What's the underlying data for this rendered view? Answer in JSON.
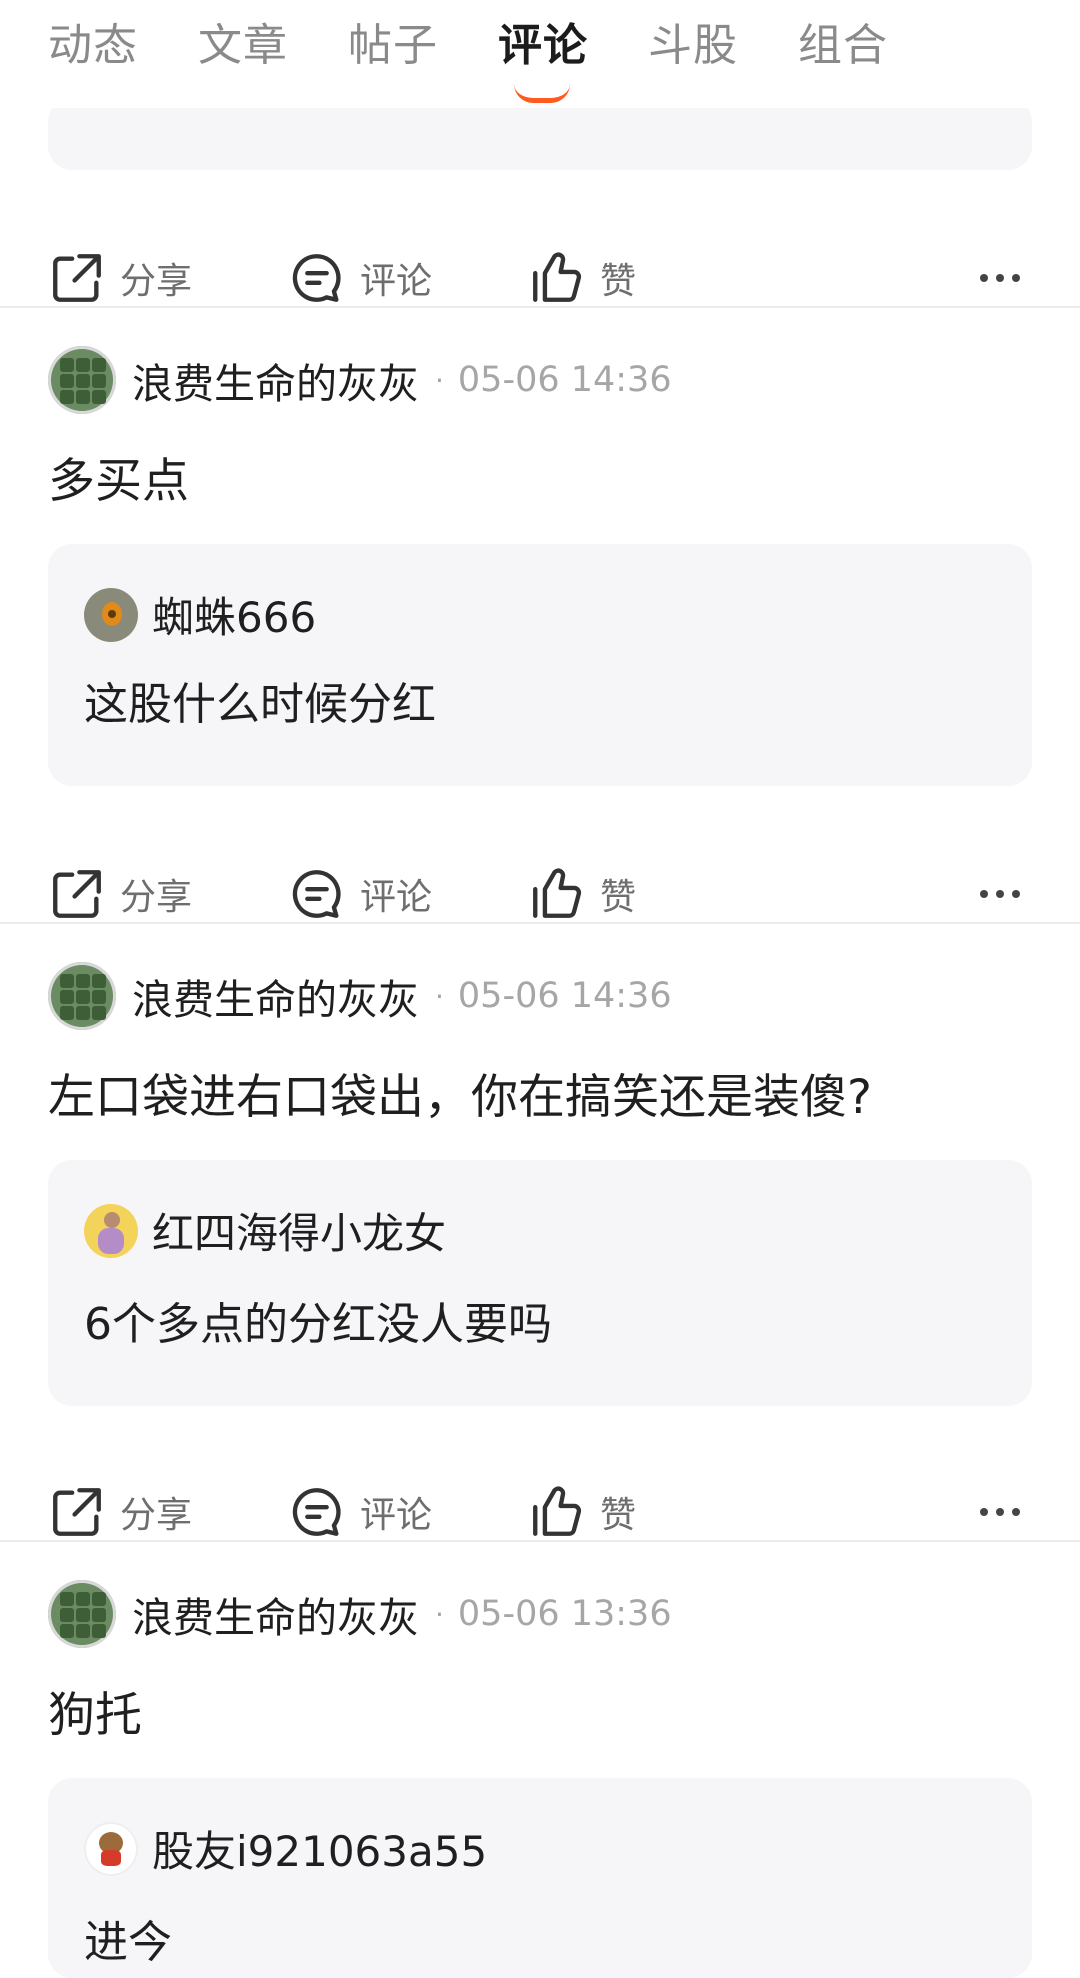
{
  "tabs": [
    {
      "label": "动态"
    },
    {
      "label": "文章"
    },
    {
      "label": "帖子"
    },
    {
      "label": "评论",
      "active": true
    },
    {
      "label": "斗股"
    },
    {
      "label": "组合"
    }
  ],
  "actions": {
    "share": "分享",
    "comment": "评论",
    "like": "赞"
  },
  "posts": [
    {
      "username": "浪费生命的灰灰",
      "separator": "·",
      "time": "05-06 14:36",
      "text": "多买点",
      "quote": {
        "username": "蜘蛛666",
        "text": "这股什么时候分红"
      }
    },
    {
      "username": "浪费生命的灰灰",
      "separator": "·",
      "time": "05-06 14:36",
      "text": "左口袋进右口袋出，你在搞笑还是装傻?",
      "quote": {
        "username": "红四海得小龙女",
        "text": "6个多点的分红没人要吗"
      }
    },
    {
      "username": "浪费生命的灰灰",
      "separator": "·",
      "time": "05-06 13:36",
      "text": "狗托",
      "quote": {
        "username": "股友i921063a55",
        "text": "进今"
      }
    }
  ],
  "colors": {
    "accent": "#ff5a1f",
    "card_bg": "#f6f6f8",
    "muted": "#a6a6a6"
  }
}
